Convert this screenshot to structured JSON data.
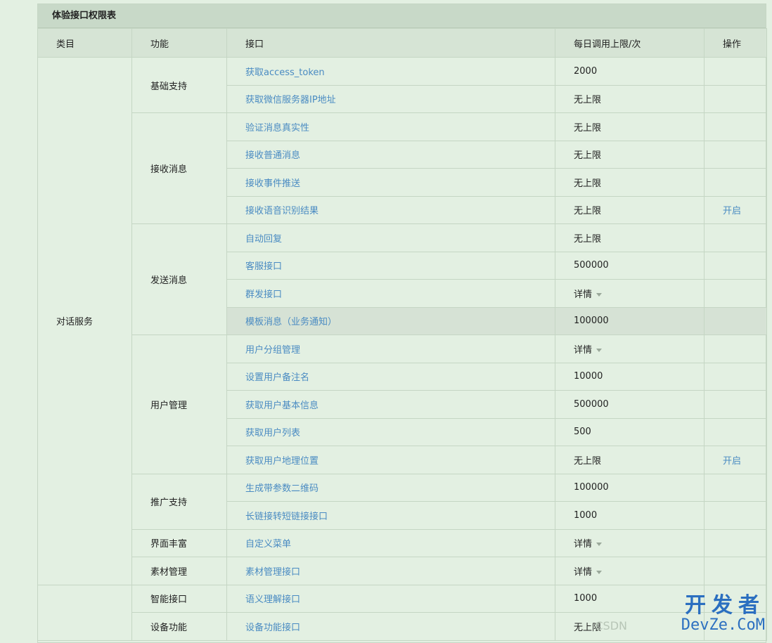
{
  "panel": {
    "title": "体验接口权限表"
  },
  "columns": {
    "category": "类目",
    "function": "功能",
    "api": "接口",
    "limit": "每日调用上限/次",
    "action": "操作"
  },
  "categories": [
    "对话服务",
    ""
  ],
  "functions": [
    "基础支持",
    "接收消息",
    "发送消息",
    "用户管理",
    "推广支持",
    "界面丰富",
    "素材管理",
    "智能接口",
    "设备功能"
  ],
  "rows": [
    {
      "api": "获取access_token",
      "limit": "2000",
      "action": ""
    },
    {
      "api": "获取微信服务器IP地址",
      "limit": "无上限",
      "action": ""
    },
    {
      "api": "验证消息真实性",
      "limit": "无上限",
      "action": ""
    },
    {
      "api": "接收普通消息",
      "limit": "无上限",
      "action": ""
    },
    {
      "api": "接收事件推送",
      "limit": "无上限",
      "action": ""
    },
    {
      "api": "接收语音识别结果",
      "limit": "无上限",
      "action": "开启"
    },
    {
      "api": "自动回复",
      "limit": "无上限",
      "action": ""
    },
    {
      "api": "客服接口",
      "limit": "500000",
      "action": ""
    },
    {
      "api": "群发接口",
      "limit": "详情",
      "action": ""
    },
    {
      "api": "模板消息（业务通知）",
      "limit": "100000",
      "action": ""
    },
    {
      "api": "用户分组管理",
      "limit": "详情",
      "action": ""
    },
    {
      "api": "设置用户备注名",
      "limit": "10000",
      "action": ""
    },
    {
      "api": "获取用户基本信息",
      "limit": "500000",
      "action": ""
    },
    {
      "api": "获取用户列表",
      "limit": "500",
      "action": ""
    },
    {
      "api": "获取用户地理位置",
      "limit": "无上限",
      "action": "开启"
    },
    {
      "api": "生成带参数二维码",
      "limit": "100000",
      "action": ""
    },
    {
      "api": "长链接转短链接接口",
      "limit": "1000",
      "action": ""
    },
    {
      "api": "自定义菜单",
      "limit": "详情",
      "action": ""
    },
    {
      "api": "素材管理接口",
      "limit": "详情",
      "action": ""
    },
    {
      "api": "语义理解接口",
      "limit": "1000",
      "action": ""
    },
    {
      "api": "设备功能接口",
      "limit": "无上限",
      "action": ""
    }
  ],
  "watermark": {
    "big": "开发者",
    "small": "DevZe.CoM",
    "csdn": "CSDN"
  },
  "colors": {
    "background": "#e3f0e2",
    "header": "#d6e4d5",
    "link": "#4a8bc2",
    "highlight": "#d6e2d5"
  }
}
